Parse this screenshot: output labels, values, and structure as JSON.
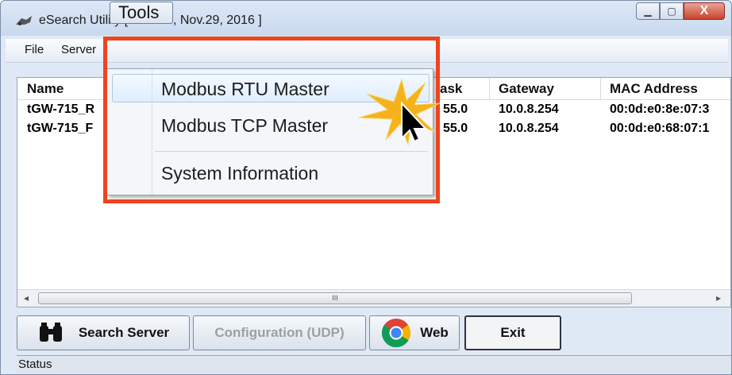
{
  "window": {
    "title": "eSearch Utility [ v1.1.13, Nov.29, 2016 ]",
    "minimize_glyph": "▁",
    "maximize_glyph": "▢",
    "close_glyph": "X"
  },
  "menubar": {
    "file": "File",
    "server": "Server",
    "tools": "Tools"
  },
  "tools_menu": {
    "items": [
      {
        "label": "Modbus RTU Master",
        "highlighted": true
      },
      {
        "label": "Modbus TCP Master",
        "highlighted": false
      },
      {
        "label": "System Information",
        "highlighted": false
      }
    ]
  },
  "table": {
    "columns": [
      "Name",
      "ask",
      "Gateway",
      "MAC Address"
    ],
    "rows": [
      {
        "name": "tGW-715_R",
        "mask": "55.0",
        "gateway": "10.0.8.254",
        "mac": "00:0d:e0:8e:07:3"
      },
      {
        "name": "tGW-715_F",
        "mask": "55.0",
        "gateway": "10.0.8.254",
        "mac": "00:0d:e0:68:07:1"
      }
    ],
    "scroll_grip": "III",
    "scroll_left": "◂",
    "scroll_right": "▸"
  },
  "buttons": {
    "search_server": "Search Server",
    "configuration": "Configuration (UDP)",
    "web": "Web",
    "exit": "Exit"
  },
  "status": {
    "text": "Status"
  },
  "colors": {
    "highlight_border": "#f0431f",
    "menu_highlight": "#dfeefe"
  }
}
